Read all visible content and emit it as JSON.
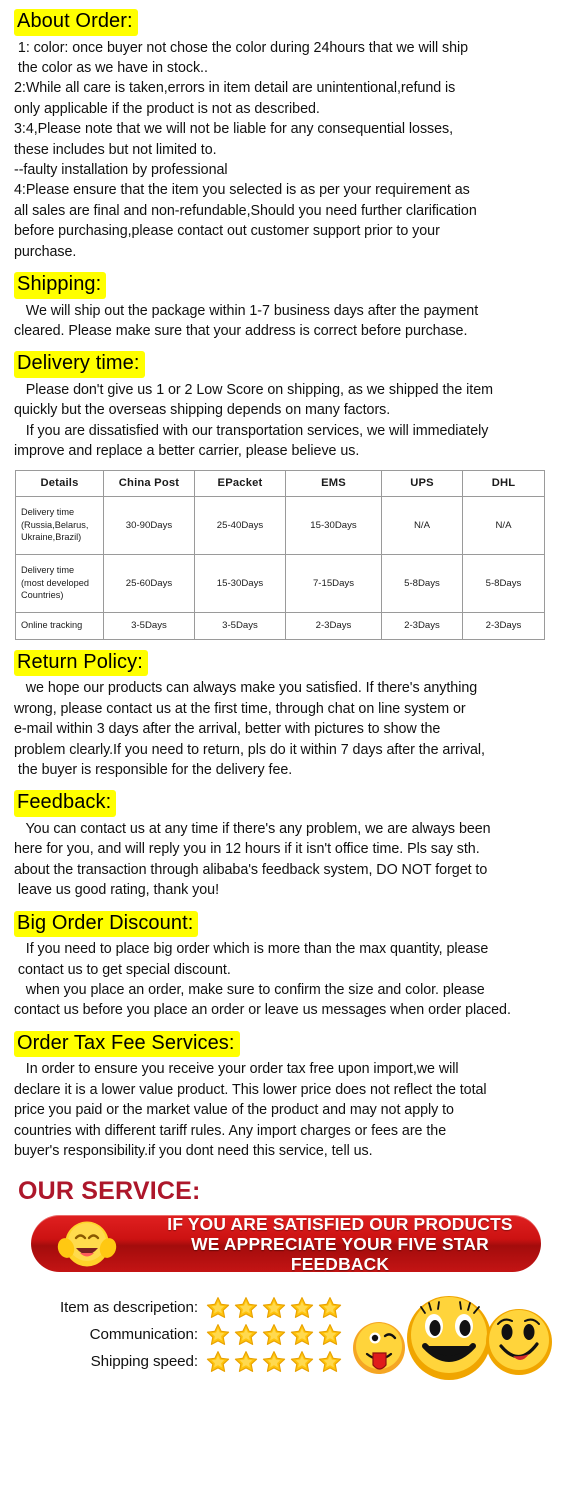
{
  "sections": [
    {
      "heading": "About Order:",
      "lines": [
        " 1: color: once buyer not chose the color during 24hours that we will ship",
        " the color as we have in stock..",
        "2:While all care is taken,errors in item detail are unintentional,refund is",
        "only applicable if the product is not as described.",
        "3:4,Please note that we will not be liable for any consequential losses,",
        "these includes but not limited to.",
        "--faulty installation by professional",
        "4:Please ensure that the item you selected is as per your requirement as",
        "all sales are final and non-refundable,Should you need further clarification",
        "before purchasing,please contact out customer support prior to your",
        "purchase."
      ]
    },
    {
      "heading": "Shipping:",
      "lines": [
        "   We will ship out the package within 1-7 business days after the payment",
        "cleared. Please make sure that your address is correct before purchase."
      ]
    },
    {
      "heading": "Delivery time:",
      "lines": [
        "   Please don't give us 1 or 2 Low Score on shipping, as we shipped the item",
        "quickly but the overseas shipping depends on many factors.",
        "   If you are dissatisfied with our transportation services, we will immediately",
        "improve and replace a better carrier, please believe us."
      ]
    },
    {
      "heading": "Return Policy:",
      "lines": [
        "   we hope our products can always make you satisfied. If there's anything",
        "wrong, please contact us at the first time, through chat on line system or",
        "e-mail within 3 days after the arrival, better with pictures to show the",
        "problem clearly.If you need to return, pls do it within 7 days after the arrival,",
        " the buyer is responsible for the delivery fee."
      ]
    },
    {
      "heading": "Feedback:",
      "lines": [
        "   You can contact us at any time if there's any problem, we are always been",
        "here for you, and will reply you in 12 hours if it isn't office time. Pls say sth.",
        "about the transaction through alibaba's feedback system, DO NOT forget to",
        " leave us good rating, thank you!"
      ]
    },
    {
      "heading": "Big Order Discount:",
      "lines": [
        "   If you need to place big order which is more than the max quantity, please",
        " contact us to get special discount.",
        "   when you place an order, make sure to confirm the size and color. please",
        "contact us before you place an order or leave us messages when order placed."
      ]
    },
    {
      "heading": "Order Tax Fee Services:",
      "lines": [
        "   In order to ensure you receive your order tax free upon import,we will",
        "declare it is a lower value product. This lower price does not reflect the total",
        "price you paid or the market value of the product and may not apply to",
        "countries with different tariff rules. Any import charges or fees are the",
        "buyer's responsibility.if you dont need this service, tell us."
      ]
    }
  ],
  "shipping_table": {
    "headers": [
      "Details",
      "China Post",
      "EPacket",
      "EMS",
      "UPS",
      "DHL"
    ],
    "rows": [
      {
        "label": "Delivery time\n(Russia,Belarus,\nUkraine,Brazil)",
        "label_lines": [
          "Delivery time",
          "(Russia,Belarus,",
          "Ukraine,Brazil)"
        ],
        "values": [
          "30-90Days",
          "25-40Days",
          "15-30Days",
          "N/A",
          "N/A"
        ]
      },
      {
        "label": "Delivery time\n(most developed\nCountries)",
        "label_lines": [
          "Delivery time",
          "(most developed",
          "Countries)"
        ],
        "values": [
          "25-60Days",
          "15-30Days",
          "7-15Days",
          "5-8Days",
          "5-8Days"
        ]
      },
      {
        "label": "Online tracking",
        "label_lines": [
          "Online tracking"
        ],
        "values": [
          "3-5Days",
          "3-5Days",
          "2-3Days",
          "2-3Days",
          "2-3Days"
        ]
      }
    ]
  },
  "our_service": {
    "title": "OUR SERVICE:",
    "title_color": "#ad172b",
    "banner": {
      "line1": "IF YOU ARE SATISFIED OUR PRODUCTS",
      "line2": "WE APPRECIATE YOUR FIVE STAR FEEDBACK",
      "background_color": "#cc1212",
      "text_color": "#ffffff",
      "emoji": "laughing-thumbs-up-emoji"
    }
  },
  "ratings": {
    "star_color": "#ffc40c",
    "star_count": 5,
    "rows": [
      {
        "label": "Item as descripetion:",
        "stars": 5
      },
      {
        "label": "Communication:",
        "stars": 5
      },
      {
        "label": "Shipping speed:",
        "stars": 5
      }
    ],
    "faces": [
      "winking-tongue-out-smiley",
      "big-smiley-with-eyelashes",
      "smiling-smiley"
    ]
  },
  "highlight_color": "#ffff00"
}
